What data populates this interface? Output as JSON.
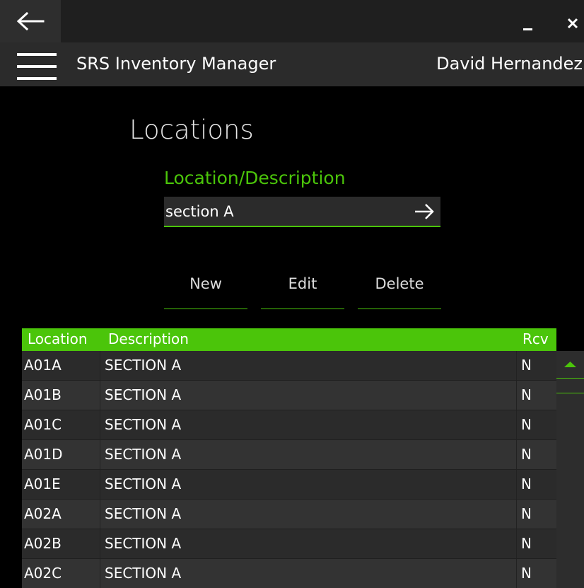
{
  "window": {
    "back_icon": "arrow-left-icon",
    "minimize_icon": "minimize-icon",
    "close_icon": "close-icon"
  },
  "appbar": {
    "menu_icon": "hamburger-menu-icon",
    "title": "SRS Inventory Manager",
    "user": "David Hernandez"
  },
  "page": {
    "title": "Locations"
  },
  "search": {
    "label": "Location/Description",
    "value": "section A",
    "go_icon": "arrow-right-icon"
  },
  "actions": {
    "new_label": "New",
    "edit_label": "Edit",
    "delete_label": "Delete"
  },
  "grid": {
    "columns": [
      "Location",
      "Description",
      "Rcv"
    ],
    "rows": [
      {
        "location": "A01A",
        "description": "SECTION A",
        "rcv": "N"
      },
      {
        "location": "A01B",
        "description": "SECTION A",
        "rcv": "N"
      },
      {
        "location": "A01C",
        "description": "SECTION A",
        "rcv": "N"
      },
      {
        "location": "A01D",
        "description": "SECTION A",
        "rcv": "N"
      },
      {
        "location": "A01E",
        "description": "SECTION A",
        "rcv": "N"
      },
      {
        "location": "A02A",
        "description": "SECTION A",
        "rcv": "N"
      },
      {
        "location": "A02B",
        "description": "SECTION A",
        "rcv": "N"
      },
      {
        "location": "A02C",
        "description": "SECTION A",
        "rcv": "N"
      }
    ]
  },
  "colors": {
    "accent": "#4bc50a",
    "background": "#000000",
    "appbar": "#2b2b2b",
    "row_even": "#2b2b2b",
    "row_odd": "#333333"
  }
}
